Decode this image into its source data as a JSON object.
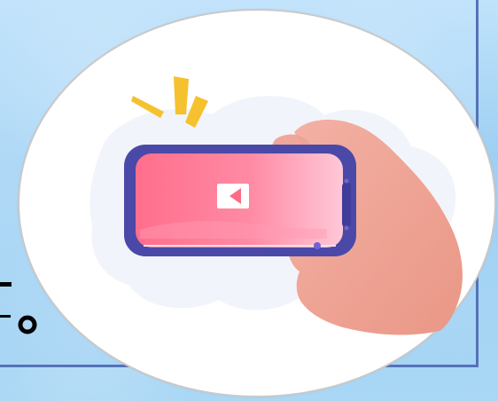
{
  "background": {
    "frame_color": "#5572b8"
  },
  "side_mark": {
    "label": "_o"
  },
  "illustration": {
    "phone_color": "#4b49a7",
    "screen_start": "#ff7d92",
    "screen_end": "#ffc0d3",
    "hand_color": "#efa79b",
    "spark_color": "#f5c12f",
    "icon": "video-play-icon"
  }
}
